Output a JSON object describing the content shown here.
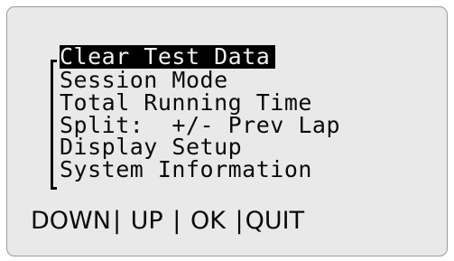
{
  "menu": {
    "items": [
      {
        "label": "Clear Test Data",
        "selected": true
      },
      {
        "label": "Session Mode",
        "selected": false
      },
      {
        "label": "Total Running Time",
        "selected": false
      },
      {
        "label": "Split:  +/- Prev Lap",
        "selected": false
      },
      {
        "label": "Display Setup",
        "selected": false
      },
      {
        "label": "System Information",
        "selected": false
      }
    ]
  },
  "softkeys": {
    "down": "DOWN",
    "up": " UP ",
    "ok": " OK ",
    "quit": "QUIT",
    "separator": "|"
  },
  "colors": {
    "screen_background": "#e9e9e9",
    "text": "#0a0a0a",
    "highlight_background": "#000000",
    "highlight_text": "#f2f2f2"
  }
}
